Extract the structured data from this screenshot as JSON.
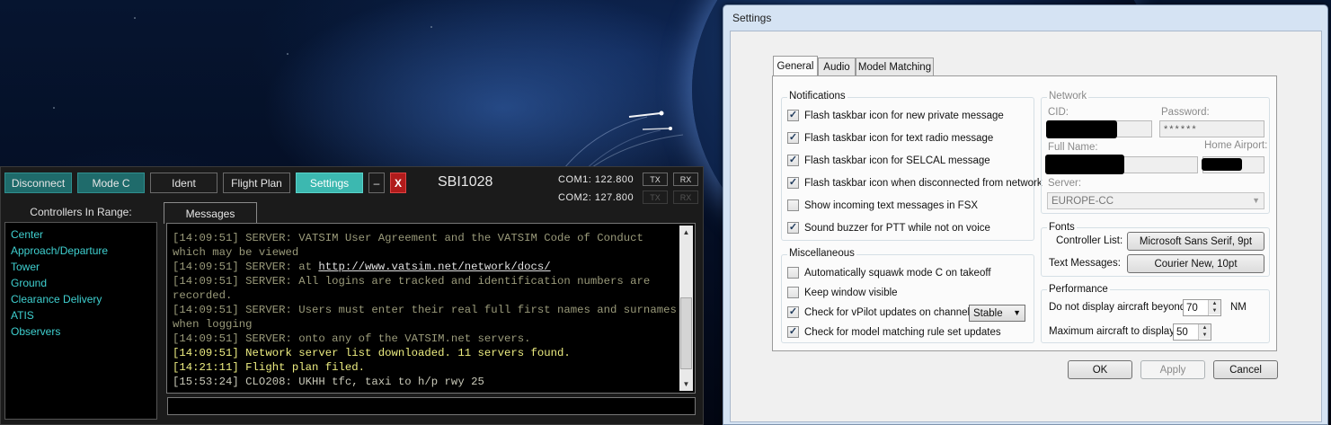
{
  "vpilot": {
    "toolbar": {
      "disconnect": "Disconnect",
      "mode_c": "Mode C",
      "ident": "Ident",
      "flight_plan": "Flight Plan",
      "settings": "Settings",
      "minimize": "–",
      "close": "X"
    },
    "callsign": "SBI1028",
    "com1": {
      "label": "COM1: 122.800",
      "tx": "TX",
      "rx": "RX"
    },
    "com2": {
      "label": "COM2: 127.800",
      "tx": "TX",
      "rx": "RX"
    },
    "controllers": {
      "title": "Controllers In Range:",
      "items": [
        "Center",
        "Approach/Departure",
        "Tower",
        "Ground",
        "Clearance Delivery",
        "ATIS",
        "Observers"
      ]
    },
    "messages_tab": "Messages",
    "messages": [
      {
        "time": "[14:09:51]",
        "text": " SERVER: VATSIM User Agreement and the VATSIM Code of Conduct which may be viewed",
        "kind": "server"
      },
      {
        "time": "[14:09:51]",
        "text": " SERVER: at ",
        "link": "http://www.vatsim.net/network/docs/",
        "kind": "server"
      },
      {
        "time": "[14:09:51]",
        "text": " SERVER: All logins are tracked and identification numbers are recorded.",
        "kind": "server"
      },
      {
        "time": "[14:09:51]",
        "text": " SERVER: Users must enter their real full first names and surnames when logging",
        "kind": "server"
      },
      {
        "time": "[14:09:51]",
        "text": " SERVER: onto any of the VATSIM.net servers.",
        "kind": "server"
      },
      {
        "time": "[14:09:51]",
        "text": " Network server list downloaded. 11 servers found.",
        "kind": "system"
      },
      {
        "time": "[14:21:11]",
        "text": " Flight plan filed.",
        "kind": "system"
      },
      {
        "time": "[15:53:24]",
        "text": " CLO208: UKHH tfc, taxi to h/p rwy 25",
        "kind": "pilot"
      }
    ]
  },
  "settings": {
    "title": "Settings",
    "tabs": [
      "General",
      "Audio",
      "Model Matching"
    ],
    "notifications": {
      "title": "Notifications",
      "items": [
        {
          "label": "Flash taskbar icon for new private message",
          "checked": true
        },
        {
          "label": "Flash taskbar icon for text radio message",
          "checked": true
        },
        {
          "label": "Flash taskbar icon for SELCAL message",
          "checked": true
        },
        {
          "label": "Flash taskbar icon when disconnected from network",
          "checked": true
        },
        {
          "label": "Show incoming text messages in FSX",
          "checked": false
        },
        {
          "label": "Sound buzzer for PTT while not on voice",
          "checked": true
        }
      ]
    },
    "misc": {
      "title": "Miscellaneous",
      "auto_squawk": {
        "label": "Automatically squawk mode C on takeoff",
        "checked": false
      },
      "keep_visible": {
        "label": "Keep window visible",
        "checked": false
      },
      "check_updates": {
        "label": "Check for vPilot updates on channel:",
        "checked": true
      },
      "channel": "Stable",
      "check_rules": {
        "label": "Check for model matching rule set updates",
        "checked": true
      }
    },
    "network": {
      "title": "Network",
      "cid_label": "CID:",
      "password_label": "Password:",
      "password_value": "******",
      "fullname_label": "Full Name:",
      "home_airport_label": "Home Airport:",
      "server_label": "Server:",
      "server_value": "EUROPE-CC"
    },
    "fonts": {
      "title": "Fonts",
      "controller_list_label": "Controller List:",
      "controller_list_value": "Microsoft Sans Serif, 9pt",
      "text_messages_label": "Text Messages:",
      "text_messages_value": "Courier New, 10pt"
    },
    "performance": {
      "title": "Performance",
      "beyond_label": "Do not display aircraft beyond",
      "beyond_value": "70",
      "beyond_unit": "NM",
      "max_label": "Maximum aircraft to display:",
      "max_value": "50"
    },
    "buttons": {
      "ok": "OK",
      "apply": "Apply",
      "cancel": "Cancel"
    }
  }
}
